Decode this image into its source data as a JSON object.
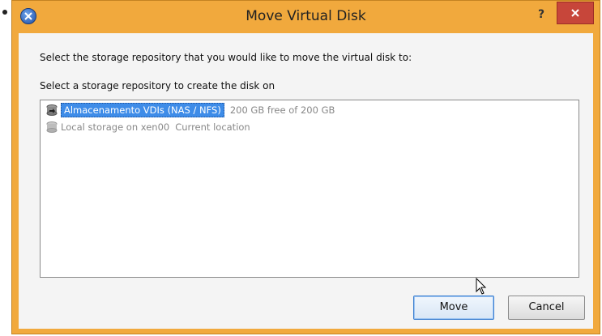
{
  "dialog": {
    "title": "Move Virtual Disk",
    "help_label": "?",
    "prompt": "Select the storage repository that you would like to move the virtual disk to:",
    "list_label": "Select a storage repository to create the disk on"
  },
  "storage_list": [
    {
      "name": "Almacenamento VDIs (NAS / NFS)",
      "note": "200 GB free of 200 GB",
      "selected": true,
      "icon": "storage-disk-icon"
    },
    {
      "name": "Local storage on xen00",
      "note": "Current location",
      "selected": false,
      "icon": "storage-disk-icon"
    }
  ],
  "buttons": {
    "move": "Move",
    "cancel": "Cancel"
  },
  "colors": {
    "title_bar": "#f1a93d",
    "selection": "#3e8ce8",
    "close_button": "#c7463a"
  }
}
